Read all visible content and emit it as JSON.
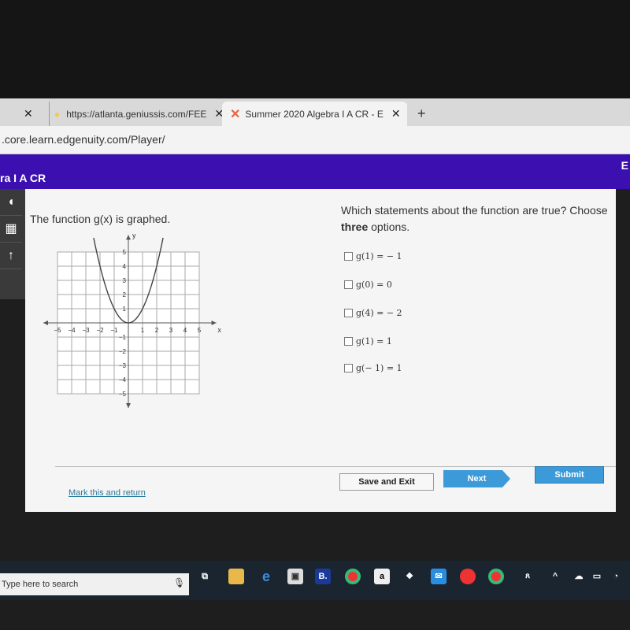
{
  "browser": {
    "tabs": [
      {
        "label": "https://atlanta.geniussis.com/FEE",
        "close": "✕"
      },
      {
        "label": "Summer 2020 Algebra I A CR - E",
        "close": "✕",
        "active": true
      }
    ],
    "prev_tab_close": "✕",
    "new_tab": "+",
    "address": ".core.learn.edgenuity.com/Player/"
  },
  "course_bar": {
    "title": "ra I A CR",
    "right_letter": "E"
  },
  "question": {
    "prompt": "The function g(x) is graphed.",
    "instruction_pre": "Which statements about the function are true? Choose ",
    "instruction_bold": "three",
    "instruction_post": " options.",
    "options": [
      {
        "label": "g(1) = − 1",
        "checked": false
      },
      {
        "label": "g(0) = 0",
        "checked": false
      },
      {
        "label": "g(4) = − 2",
        "checked": false
      },
      {
        "label": "g(1) = 1",
        "checked": false
      },
      {
        "label": "g(− 1) = 1",
        "checked": false
      }
    ]
  },
  "graph": {
    "x_label": "x",
    "y_label": "y",
    "x_ticks": [
      "−5",
      "−4",
      "−3",
      "−2",
      "−1",
      "1",
      "2",
      "3",
      "4",
      "5"
    ],
    "y_ticks": [
      "5",
      "4",
      "3",
      "2",
      "1",
      "−1",
      "−2",
      "−3",
      "−4",
      "−5"
    ],
    "function": "x^2"
  },
  "footer": {
    "mark": "Mark this and return",
    "save": "Save and Exit",
    "next": "Next",
    "submit": "Submit"
  },
  "taskbar": {
    "search_placeholder": "Type here to search",
    "icons": [
      "mic-icon",
      "task-view-icon",
      "file-explorer-icon",
      "edge-icon",
      "store-icon",
      "b-app-icon",
      "chrome-icon",
      "amazon-icon",
      "dropbox-icon",
      "mail-icon",
      "chrome-profile-icon",
      "chrome-s-icon"
    ]
  },
  "colors": {
    "purple": "#3c10b0",
    "button_blue": "#3c9ad8",
    "link": "#2a7a9a"
  }
}
